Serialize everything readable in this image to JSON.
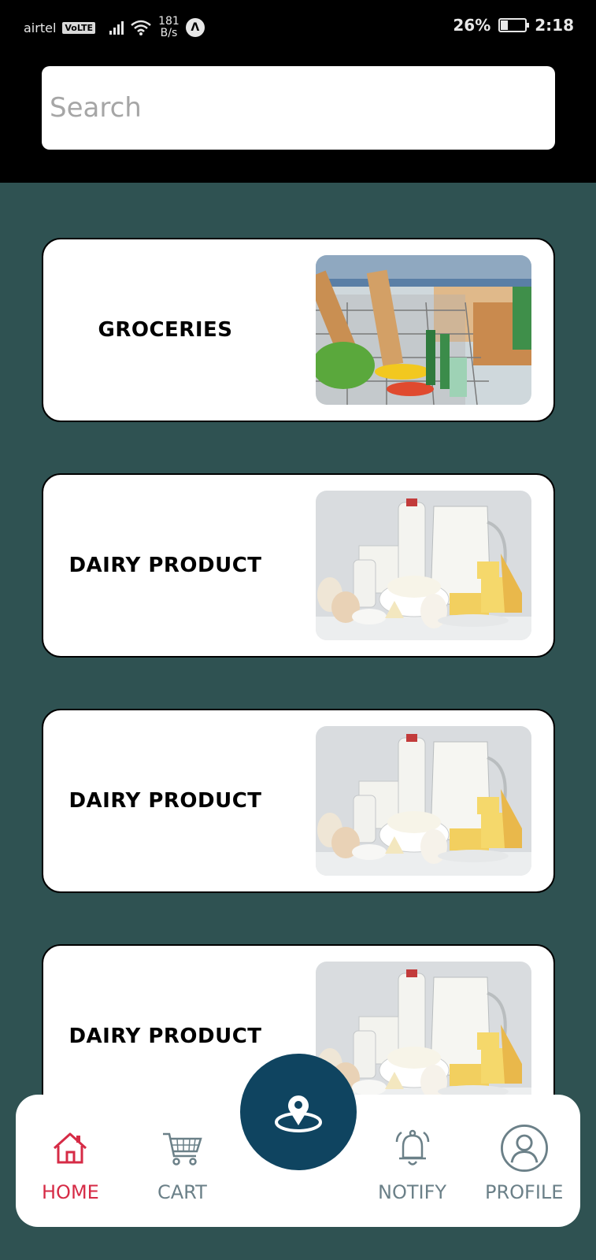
{
  "status_bar": {
    "carrier": "airtel",
    "volte": "VoLTE",
    "speed_value": "181",
    "speed_unit": "B/s",
    "battery": "26%",
    "battery_level": 0.26,
    "time": "2:18"
  },
  "search": {
    "placeholder": "Search"
  },
  "categories": [
    {
      "title": "GROCERIES",
      "image": "grocery-cart-image"
    },
    {
      "title": "DAIRY PRODUCT",
      "image": "dairy-products-image"
    },
    {
      "title": "DAIRY PRODUCT",
      "image": "dairy-products-image"
    },
    {
      "title": "DAIRY PRODUCT",
      "image": "dairy-products-image"
    }
  ],
  "bottom_nav": {
    "home": "HOME",
    "cart": "CART",
    "notify": "NOTIFY",
    "profile": "PROFILE",
    "fab_icon": "location-pin-icon"
  },
  "colors": {
    "background": "#2f5252",
    "header": "#000000",
    "fab": "#0f4460",
    "active_nav": "#d62b46",
    "inactive_nav": "#6b8088"
  }
}
